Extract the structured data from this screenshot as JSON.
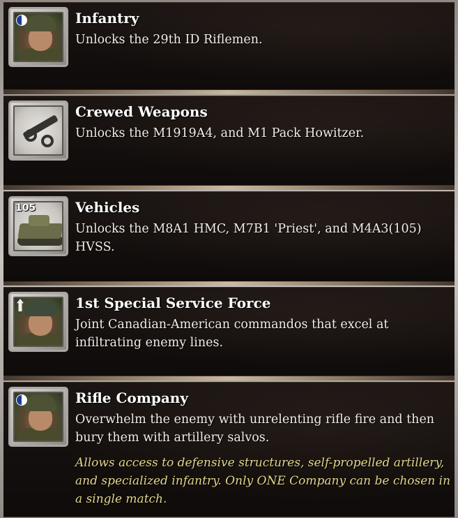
{
  "items": [
    {
      "title": "Infantry",
      "description": "Unlocks the 29th ID Riflemen.",
      "icon": "infantry-portrait-icon"
    },
    {
      "title": "Crewed Weapons",
      "description": "Unlocks  the M1919A4, and M1 Pack Howitzer.",
      "icon": "howitzer-icon"
    },
    {
      "title": "Vehicles",
      "description": "Unlocks the M8A1 HMC, M7B1 'Priest', and M4A3(105) HVSS.",
      "icon": "tank-icon",
      "icon_label": "105"
    },
    {
      "title": "1st Special Service Force",
      "description": "Joint Canadian-American commandos that excel at infiltrating enemy lines.",
      "icon": "commando-portrait-icon"
    },
    {
      "title": "Rifle Company",
      "description": "Overwhelm the enemy with unrelenting rifle fire and then bury them with artillery salvos.",
      "note": "Allows access to defensive structures, self-propelled artillery, and specialized infantry. Only ONE Company can be chosen in a single match.",
      "icon": "rifle-company-portrait-icon"
    }
  ],
  "colors": {
    "title": "#ffffff",
    "description": "#f1ede8",
    "note": "#e2d68a",
    "card_background": "#0e0b0a",
    "frame": "#a9a7a4"
  }
}
